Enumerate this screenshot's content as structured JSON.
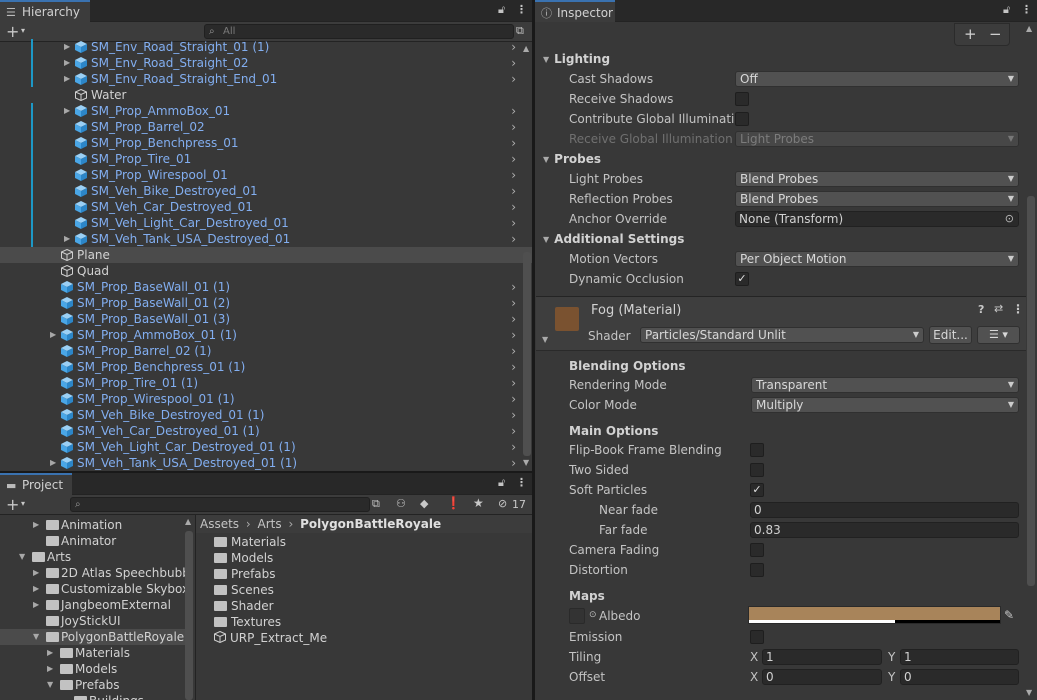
{
  "hierarchy": {
    "tab_title": "Hierarchy",
    "search_placeholder": "All",
    "rows": [
      {
        "label": "SM_Env_Road_Straight_01 (1)"
      },
      {
        "label": "SM_Env_Road_Straight_02"
      },
      {
        "label": "SM_Env_Road_Straight_End_01"
      },
      {
        "label": "Water"
      },
      {
        "label": "SM_Prop_AmmoBox_01"
      },
      {
        "label": "SM_Prop_Barrel_02"
      },
      {
        "label": "SM_Prop_Benchpress_01"
      },
      {
        "label": "SM_Prop_Tire_01"
      },
      {
        "label": "SM_Prop_Wirespool_01"
      },
      {
        "label": "SM_Veh_Bike_Destroyed_01"
      },
      {
        "label": "SM_Veh_Car_Destroyed_01"
      },
      {
        "label": "SM_Veh_Light_Car_Destroyed_01"
      },
      {
        "label": "SM_Veh_Tank_USA_Destroyed_01"
      },
      {
        "label": "Plane"
      },
      {
        "label": "Quad"
      },
      {
        "label": "SM_Prop_BaseWall_01 (1)"
      },
      {
        "label": "SM_Prop_BaseWall_01 (2)"
      },
      {
        "label": "SM_Prop_BaseWall_01 (3)"
      },
      {
        "label": "SM_Prop_AmmoBox_01 (1)"
      },
      {
        "label": "SM_Prop_Barrel_02 (1)"
      },
      {
        "label": "SM_Prop_Benchpress_01 (1)"
      },
      {
        "label": "SM_Prop_Tire_01 (1)"
      },
      {
        "label": "SM_Prop_Wirespool_01 (1)"
      },
      {
        "label": "SM_Veh_Bike_Destroyed_01 (1)"
      },
      {
        "label": "SM_Veh_Car_Destroyed_01 (1)"
      },
      {
        "label": "SM_Veh_Light_Car_Destroyed_01 (1)"
      },
      {
        "label": "SM_Veh_Tank_USA_Destroyed_01 (1)"
      }
    ]
  },
  "project": {
    "tab_title": "Project",
    "hidden_count": "17",
    "tree": [
      {
        "label": "Animation"
      },
      {
        "label": "Animator"
      },
      {
        "label": "Arts"
      },
      {
        "label": "2D Atlas Speechbubb"
      },
      {
        "label": "Customizable Skybox"
      },
      {
        "label": "JangbeomExternal"
      },
      {
        "label": "JoyStickUI"
      },
      {
        "label": "PolygonBattleRoyale"
      },
      {
        "label": "Materials"
      },
      {
        "label": "Models"
      },
      {
        "label": "Prefabs"
      },
      {
        "label": "Buildings"
      }
    ],
    "breadcrumb": [
      "Assets",
      "Arts",
      "PolygonBattleRoyale"
    ],
    "breadcrumb_sep": "›",
    "files": [
      {
        "label": "Materials"
      },
      {
        "label": "Models"
      },
      {
        "label": "Prefabs"
      },
      {
        "label": "Scenes"
      },
      {
        "label": "Shader"
      },
      {
        "label": "Textures"
      },
      {
        "label": "URP_Extract_Me"
      }
    ]
  },
  "inspector": {
    "tab_title": "Inspector",
    "plus": "+",
    "minus": "−",
    "lighting": {
      "header": "Lighting",
      "cast_shadows_label": "Cast Shadows",
      "cast_shadows_value": "Off",
      "receive_shadows_label": "Receive Shadows",
      "contribute_gi_label": "Contribute Global Illumination",
      "receive_gi_label": "Receive Global Illumination",
      "receive_gi_value": "Light Probes"
    },
    "probes": {
      "header": "Probes",
      "light_probes_label": "Light Probes",
      "light_probes_value": "Blend Probes",
      "reflection_probes_label": "Reflection Probes",
      "reflection_probes_value": "Blend Probes",
      "anchor_label": "Anchor Override",
      "anchor_value": "None (Transform)"
    },
    "additional": {
      "header": "Additional Settings",
      "motion_vectors_label": "Motion Vectors",
      "motion_vectors_value": "Per Object Motion",
      "dynamic_occlusion_label": "Dynamic Occlusion"
    },
    "material": {
      "title": "Fog (Material)",
      "swatch_color": "#7a5230",
      "shader_label": "Shader",
      "shader_value": "Particles/Standard Unlit",
      "edit_label": "Edit...",
      "blending_header": "Blending Options",
      "rendering_mode_label": "Rendering Mode",
      "rendering_mode_value": "Transparent",
      "color_mode_label": "Color Mode",
      "color_mode_value": "Multiply",
      "main_header": "Main Options",
      "flipbook_label": "Flip-Book Frame Blending",
      "two_sided_label": "Two Sided",
      "soft_particles_label": "Soft Particles",
      "near_fade_label": "Near fade",
      "near_fade_value": "0",
      "far_fade_label": "Far fade",
      "far_fade_value": "0.83",
      "camera_fading_label": "Camera Fading",
      "distortion_label": "Distortion",
      "maps_header": "Maps",
      "albedo_label": "Albedo",
      "albedo_color": "#a8845a",
      "albedo_alpha": 0.58,
      "emission_label": "Emission",
      "tiling_label": "Tiling",
      "offset_label": "Offset",
      "x_label": "X",
      "y_label": "Y",
      "tiling_x": "1",
      "tiling_y": "1",
      "offset_x": "0",
      "offset_y": "0"
    }
  }
}
